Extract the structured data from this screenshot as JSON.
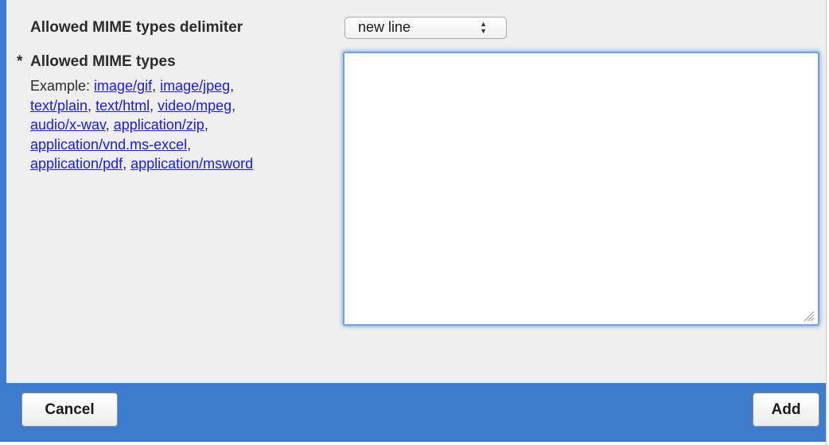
{
  "form": {
    "delimiter_label": "Allowed MIME types delimiter",
    "delimiter_value": "new line",
    "required_marker": "*",
    "mime_label": "Allowed MIME types",
    "example_prefix": "Example: ",
    "examples": [
      "image/gif",
      "image/jpeg",
      "text/plain",
      "text/html",
      "video/mpeg",
      "audio/x-wav",
      "application/zip",
      "application/vnd.ms-excel",
      "application/pdf",
      "application/msword"
    ],
    "separator": ", ",
    "mime_value": ""
  },
  "footer": {
    "cancel_label": "Cancel",
    "add_label": "Add"
  },
  "colors": {
    "accent": "#3d7ccc",
    "panel_background": "#efefef",
    "link": "#1a1ae6"
  },
  "icons": {
    "select_arrows": "updown-arrows-icon",
    "resize_grip": "resize-grip-icon"
  }
}
